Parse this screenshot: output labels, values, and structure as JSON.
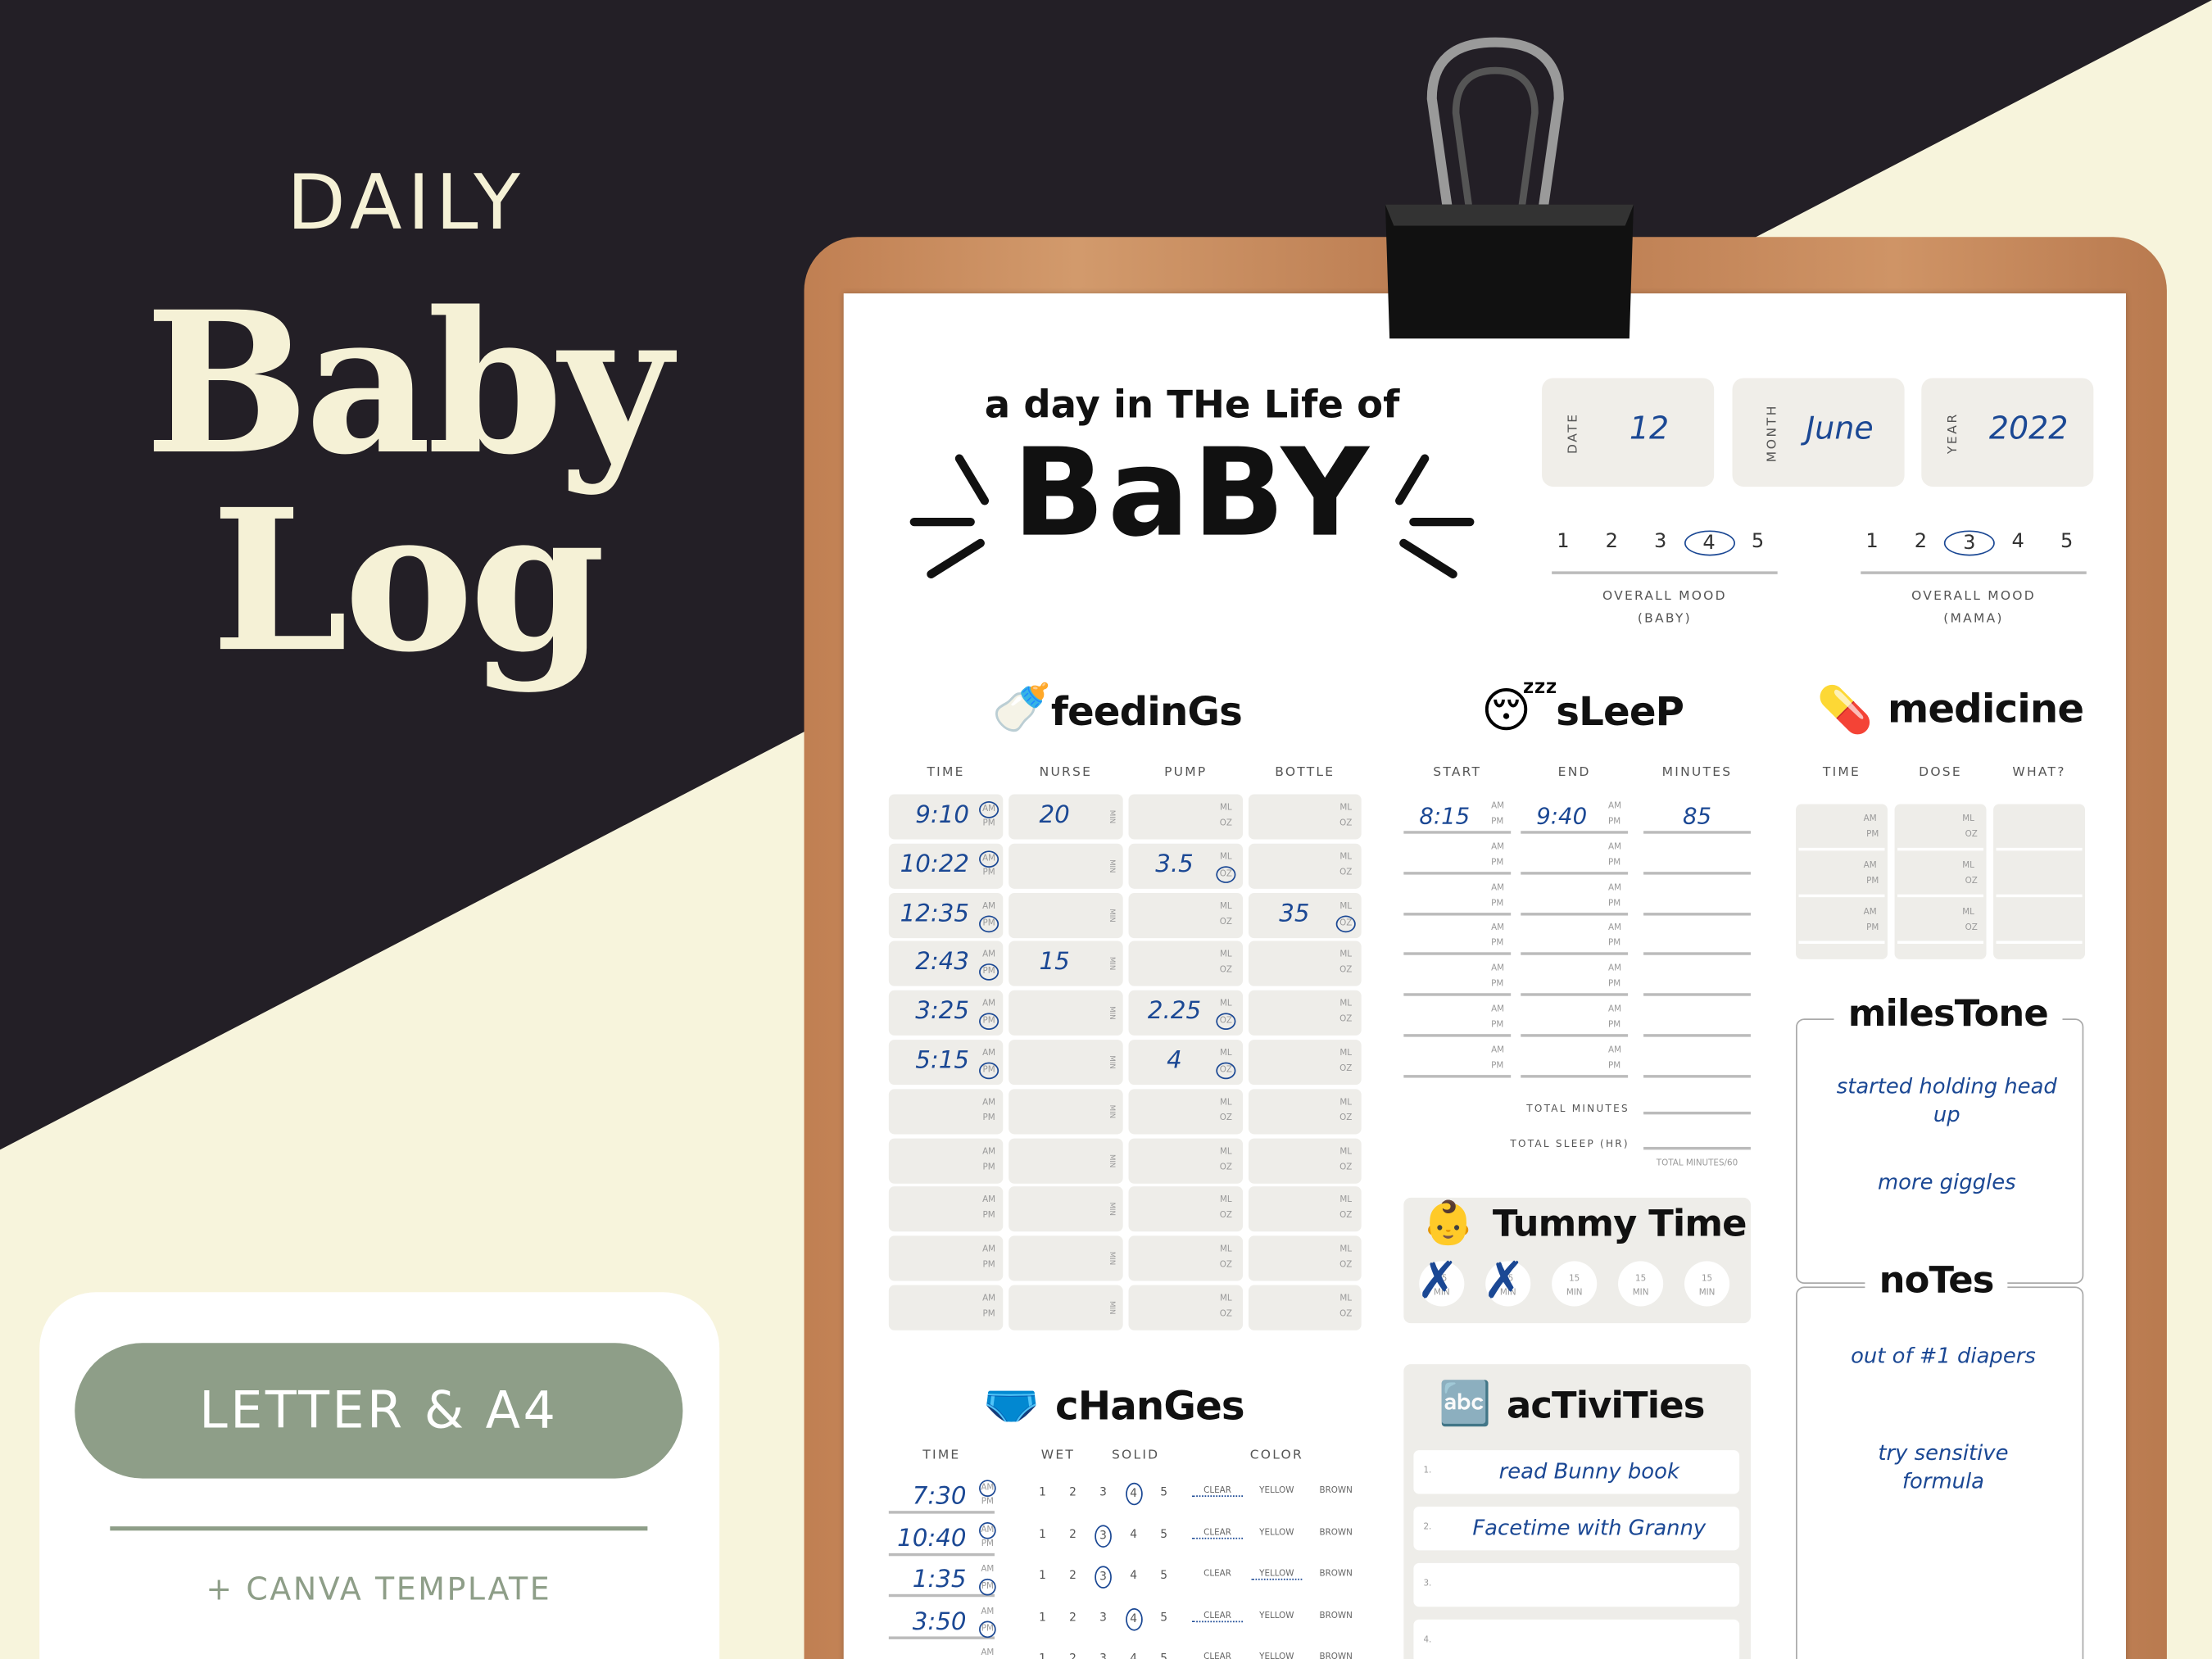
{
  "promo": {
    "line1": "DAILY",
    "line2": "Baby",
    "line3": "Log",
    "format_badge": "LETTER & A4",
    "extra": "+ CANVA TEMPLATE"
  },
  "colors": {
    "dark_bg": "#231f26",
    "cream": "#f7f4dc",
    "sage": "#8e9e88",
    "ink_blue": "#1b4894"
  },
  "planner": {
    "heading_small": "a day in THe Life of",
    "heading_big": "BaBY",
    "date": {
      "date_label": "DATE",
      "date_value": "12",
      "month_label": "MONTH",
      "month_value": "June",
      "year_label": "YEAR",
      "year_value": "2022"
    },
    "mood_baby": {
      "scale": [
        "1",
        "2",
        "3",
        "4",
        "5"
      ],
      "selected": "4",
      "label": "OVERALL MOOD",
      "sub": "(BABY)"
    },
    "mood_mama": {
      "scale": [
        "1",
        "2",
        "3",
        "4",
        "5"
      ],
      "selected": "3",
      "label": "OVERALL MOOD",
      "sub": "(MAMA)"
    },
    "feedings": {
      "title": "feedinGs",
      "icon": "baby-bottle-icon",
      "columns": [
        "TIME",
        "NURSE",
        "PUMP",
        "BOTTLE"
      ],
      "am": "AM",
      "pm": "PM",
      "min": "MIN",
      "ml": "ML",
      "oz": "OZ",
      "rows": [
        {
          "time": "9:10",
          "ampm": "AM",
          "nurse": "20",
          "pump": "",
          "pump_unit": "",
          "bottle": "",
          "bottle_unit": ""
        },
        {
          "time": "10:22",
          "ampm": "AM",
          "nurse": "",
          "pump": "3.5",
          "pump_unit": "OZ",
          "bottle": "",
          "bottle_unit": ""
        },
        {
          "time": "12:35",
          "ampm": "PM",
          "nurse": "",
          "pump": "",
          "pump_unit": "",
          "bottle": "35",
          "bottle_unit": "OZ"
        },
        {
          "time": "2:43",
          "ampm": "PM",
          "nurse": "15",
          "pump": "",
          "pump_unit": "",
          "bottle": "",
          "bottle_unit": ""
        },
        {
          "time": "3:25",
          "ampm": "PM",
          "nurse": "",
          "pump": "2.25",
          "pump_unit": "OZ",
          "bottle": "",
          "bottle_unit": ""
        },
        {
          "time": "5:15",
          "ampm": "PM",
          "nurse": "",
          "pump": "4",
          "pump_unit": "OZ",
          "bottle": "",
          "bottle_unit": ""
        },
        {
          "time": "",
          "ampm": "",
          "nurse": "",
          "pump": "",
          "pump_unit": "",
          "bottle": "",
          "bottle_unit": ""
        },
        {
          "time": "",
          "ampm": "",
          "nurse": "",
          "pump": "",
          "pump_unit": "",
          "bottle": "",
          "bottle_unit": ""
        },
        {
          "time": "",
          "ampm": "",
          "nurse": "",
          "pump": "",
          "pump_unit": "",
          "bottle": "",
          "bottle_unit": ""
        },
        {
          "time": "",
          "ampm": "",
          "nurse": "",
          "pump": "",
          "pump_unit": "",
          "bottle": "",
          "bottle_unit": ""
        },
        {
          "time": "",
          "ampm": "",
          "nurse": "",
          "pump": "",
          "pump_unit": "",
          "bottle": "",
          "bottle_unit": ""
        }
      ]
    },
    "sleep": {
      "title": "sLeeP",
      "icon": "sleeping-baby-icon",
      "columns": [
        "START",
        "END",
        "MINUTES"
      ],
      "rows": [
        {
          "start": "8:15",
          "end": "9:40",
          "minutes": "85"
        },
        {
          "start": "",
          "end": "",
          "minutes": ""
        },
        {
          "start": "",
          "end": "",
          "minutes": ""
        },
        {
          "start": "",
          "end": "",
          "minutes": ""
        },
        {
          "start": "",
          "end": "",
          "minutes": ""
        },
        {
          "start": "",
          "end": "",
          "minutes": ""
        },
        {
          "start": "",
          "end": "",
          "minutes": ""
        }
      ],
      "total_minutes_label": "TOTAL MINUTES",
      "total_sleep_label": "TOTAL SLEEP (HR)",
      "total_sleep_hint": "TOTAL MINUTES/60"
    },
    "medicine": {
      "title": "medicine",
      "icon": "medicine-bottle-icon",
      "columns": [
        "TIME",
        "DOSE",
        "WHAT?"
      ],
      "rows": 3
    },
    "milestone": {
      "title": "milesTone",
      "entries": [
        "started holding head up",
        "more giggles"
      ]
    },
    "notes": {
      "title": "noTes",
      "entries": [
        "out of #1 diapers",
        "try sensitive formula"
      ]
    },
    "tummy_time": {
      "title": "Tummy Time",
      "icon": "crawling-baby-icon",
      "slot_label": "15",
      "slot_unit": "MIN",
      "slots": 5,
      "completed": 2
    },
    "activities": {
      "title": "acTiviTies",
      "icon": "abc-blocks-icon",
      "items": [
        {
          "n": "1.",
          "text": "read Bunny book"
        },
        {
          "n": "2.",
          "text": "Facetime with Granny"
        },
        {
          "n": "3.",
          "text": ""
        },
        {
          "n": "4.",
          "text": ""
        }
      ]
    },
    "changes": {
      "title": "cHanGes",
      "icon": "diaper-icon",
      "columns": [
        "TIME",
        "WET",
        "SOLID",
        "COLOR"
      ],
      "scale": [
        "1",
        "2",
        "3",
        "4",
        "5"
      ],
      "colors": [
        "CLEAR",
        "YELLOW",
        "BROWN"
      ],
      "rows": [
        {
          "time": "7:30",
          "ampm": "AM",
          "level": "4",
          "color": "CLEAR"
        },
        {
          "time": "10:40",
          "ampm": "AM",
          "level": "3",
          "color": "CLEAR"
        },
        {
          "time": "1:35",
          "ampm": "PM",
          "level": "3",
          "color": "YELLOW"
        },
        {
          "time": "3:50",
          "ampm": "PM",
          "level": "4",
          "color": "CLEAR"
        },
        {
          "time": "",
          "ampm": "",
          "level": "",
          "color": ""
        }
      ]
    }
  }
}
